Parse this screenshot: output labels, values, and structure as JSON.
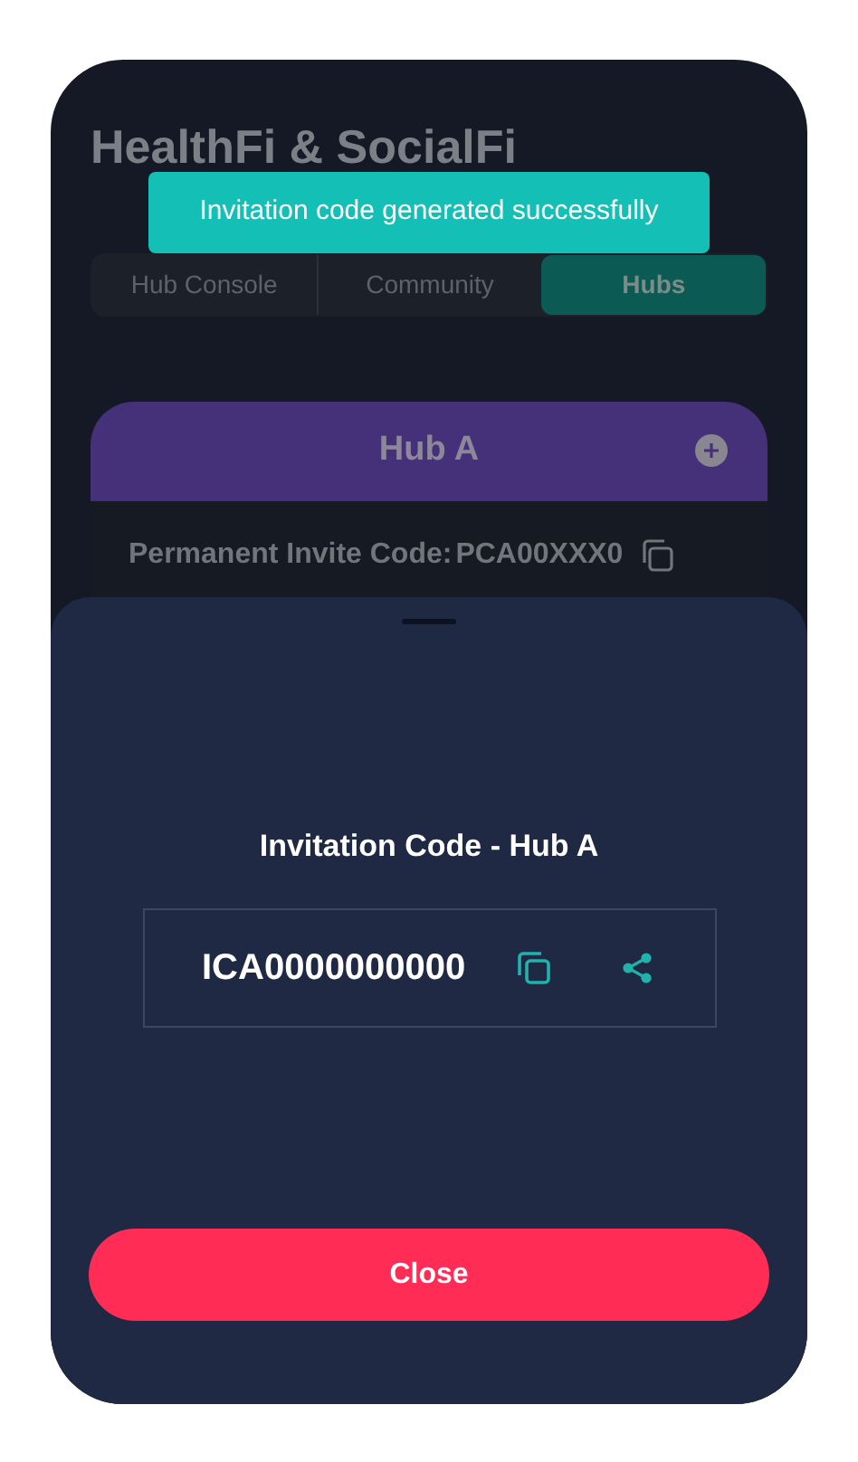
{
  "app": {
    "title": "HealthFi & SocialFi"
  },
  "toast": {
    "message": "Invitation code generated successfully"
  },
  "tabs": [
    {
      "label": "Hub Console",
      "selected": false
    },
    {
      "label": "Community",
      "selected": false
    },
    {
      "label": "Hubs",
      "selected": true
    }
  ],
  "hub_card": {
    "name": "Hub A",
    "invite_label": "Permanent Invite Code:",
    "invite_code": "PCA00XXX0"
  },
  "sheet": {
    "title": "Invitation Code - Hub A",
    "code": "ICA0000000000",
    "close_button": "Close"
  }
}
